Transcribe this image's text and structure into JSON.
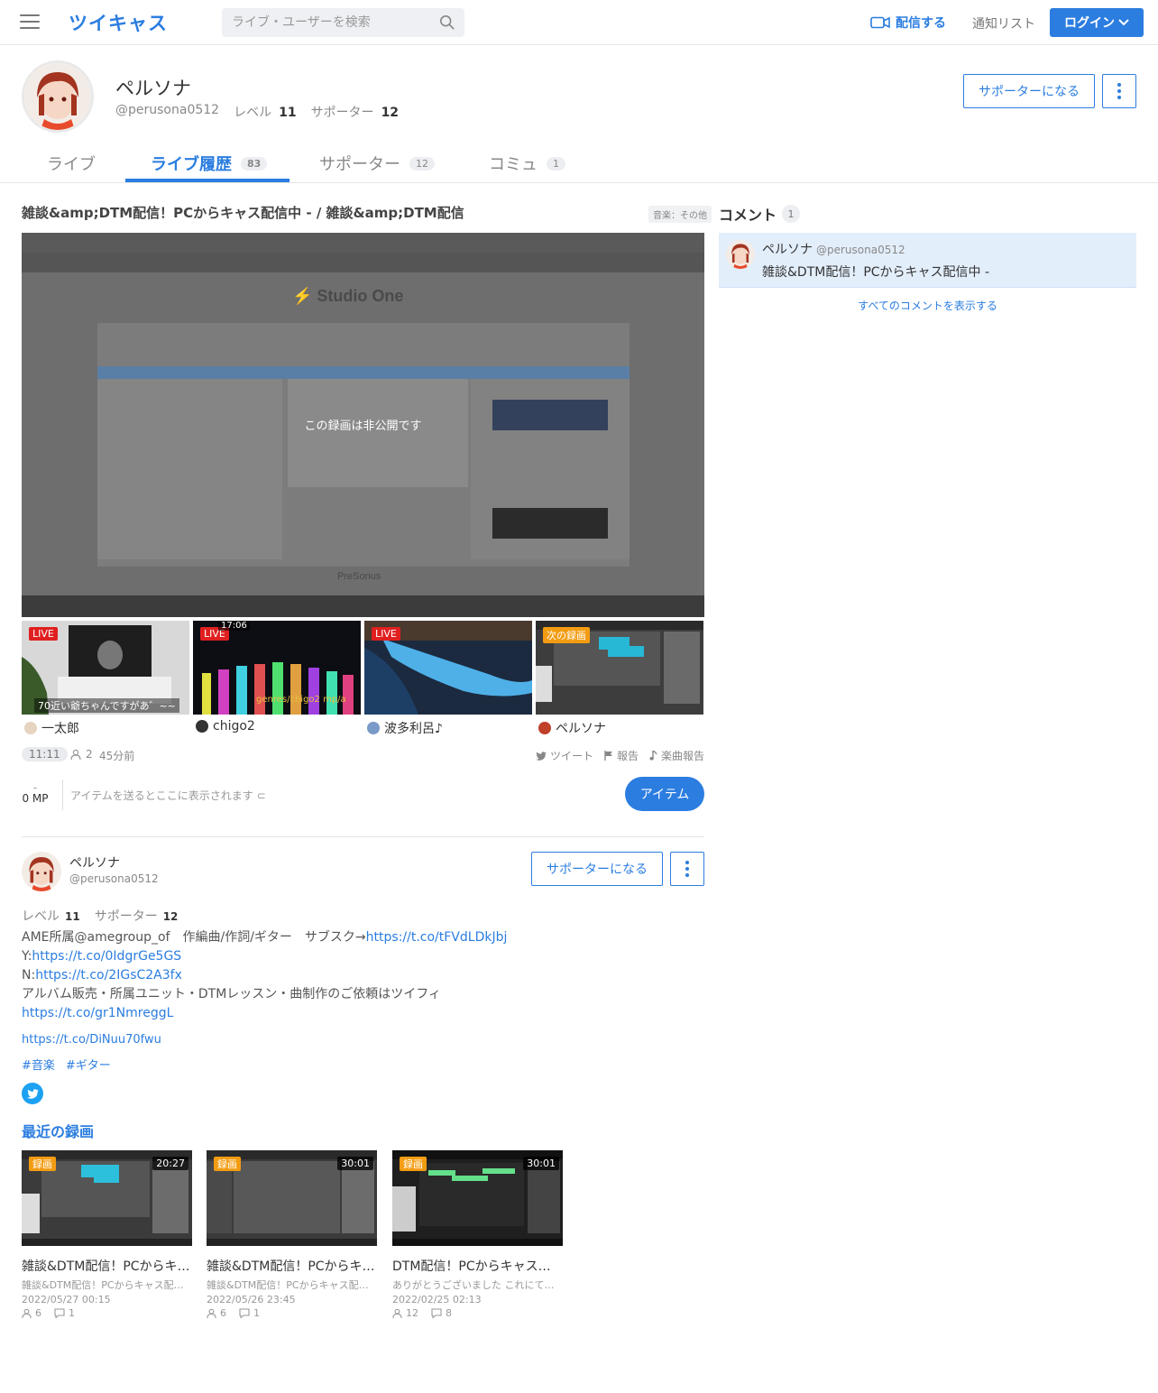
{
  "header": {
    "logo": "ツイキャス",
    "search_placeholder": "ライブ・ユーザーを検索",
    "broadcast_label": "配信する",
    "notify_label": "通知リスト",
    "login_label": "ログイン"
  },
  "profile": {
    "name": "ペルソナ",
    "handle": "@perusona0512",
    "level_label": "レベル",
    "level": "11",
    "supporter_label": "サポーター",
    "supporters": "12",
    "become_supporter": "サポーターになる"
  },
  "tabs": [
    {
      "label": "ライブ",
      "count": ""
    },
    {
      "label": "ライブ履歴",
      "count": "83"
    },
    {
      "label": "サポーター",
      "count": "12"
    },
    {
      "label": "コミュ",
      "count": "1"
    }
  ],
  "live": {
    "title": "雑談&amp;DTM配信！PCからキャス配信中 - / 雑談&amp;DTM配信",
    "category": "音楽：その他",
    "private_msg": "この録画は非公開です",
    "duration": "11:11",
    "viewers": "2",
    "ago": "45分前",
    "tweet": "ツイート",
    "report": "報告",
    "song_report": "楽曲報告",
    "mp_dash": "-",
    "mp": "0 MP",
    "items_note": "アイテムを送るとここに表示されます ⊂",
    "item_button": "アイテム"
  },
  "thumbs": [
    {
      "badge": "LIVE",
      "caption": "70近い爺ちゃんですがあ゛~~",
      "user": "一太郎"
    },
    {
      "badge": "LIVE",
      "time": "17:06",
      "user": "chigo2",
      "overlay": "genres/chigo2 mp/a"
    },
    {
      "badge": "LIVE",
      "user": "波多利呂♪"
    },
    {
      "badge": "次の録画",
      "user": "ペルソナ"
    }
  ],
  "bio": {
    "line1_text": "AME所属@amegroup_of　作編曲/作詞/ギター　サブスク→",
    "line1_link": "https://t.co/tFVdLDkJbj",
    "line2_prefix": "Y:",
    "line2_link": "https://t.co/0IdgrGe5GS",
    "line3_prefix": "N:",
    "line3_link": "https://t.co/2IGsC2A3fx",
    "line4": "アルバム販売・所属ユニット・DTMレッスン・曲制作のご依頼はツイフィ",
    "line5_link": "https://t.co/gr1NmreggL",
    "extra_link": "https://t.co/DiNuu70fwu",
    "tags": [
      "#音楽",
      "#ギター"
    ]
  },
  "recent": {
    "heading": "最近の録画",
    "items": [
      {
        "badge": "録画",
        "duration": "20:27",
        "title": "雑談&DTM配信！PCからキャス配信中 -",
        "sub": "雑談&DTM配信！PCからキャス配信中 -",
        "date": "2022/05/27 00:15",
        "views": "6",
        "comments": "1"
      },
      {
        "badge": "録画",
        "duration": "30:01",
        "title": "雑談&DTM配信！PCからキャス配信中 -",
        "sub": "雑談&DTM配信！PCからキャス配信中 -",
        "date": "2022/05/26 23:45",
        "views": "6",
        "comments": "1"
      },
      {
        "badge": "録画",
        "duration": "30:01",
        "title": "DTM配信！PCからキャス配信中 -",
        "sub": "ありがとうございました これにて終了です",
        "date": "2022/02/25 02:13",
        "views": "12",
        "comments": "8"
      }
    ]
  },
  "comments": {
    "heading": "コメント",
    "count": "1",
    "items": [
      {
        "name": "ペルソナ",
        "handle": "@perusona0512",
        "text": "雑談&DTM配信！PCからキャス配信中 -"
      }
    ],
    "show_all": "すべてのコメントを表示する"
  },
  "colors": {
    "accent": "#2b7de0",
    "live": "#e02020",
    "recording": "#f39c12"
  }
}
